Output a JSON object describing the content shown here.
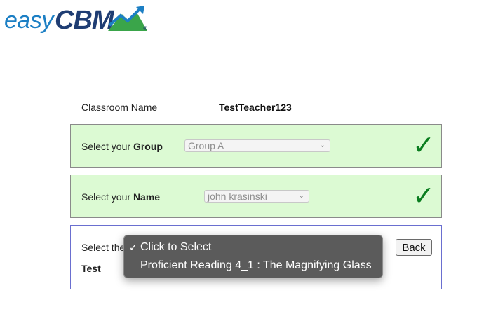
{
  "logo": {
    "easy": "easy",
    "cbm": "CBM",
    "reg": "®"
  },
  "classroom": {
    "label": "Classroom Name",
    "value": "TestTeacher123"
  },
  "group_panel": {
    "label_prefix": "Select your ",
    "label_bold": "Group",
    "selected": "Group A",
    "check": "✓"
  },
  "name_panel": {
    "label_prefix": "Select your ",
    "label_bold": "Name",
    "selected": "john krasinski",
    "check": "✓"
  },
  "test_panel": {
    "label_prefix": "Select the",
    "label_bold": "Test",
    "back_label": "Back"
  },
  "dropdown": {
    "items": [
      {
        "label": "Click to Select",
        "checked": true
      },
      {
        "label": "Proficient Reading 4_1 : The Magnifying Glass",
        "checked": false
      }
    ],
    "check_mark": "✓"
  },
  "colors": {
    "panel_green": "#dcfad3",
    "check_green": "#0a7d1f",
    "logo_blue": "#1c7fc4",
    "logo_navy": "#1f3d73"
  }
}
